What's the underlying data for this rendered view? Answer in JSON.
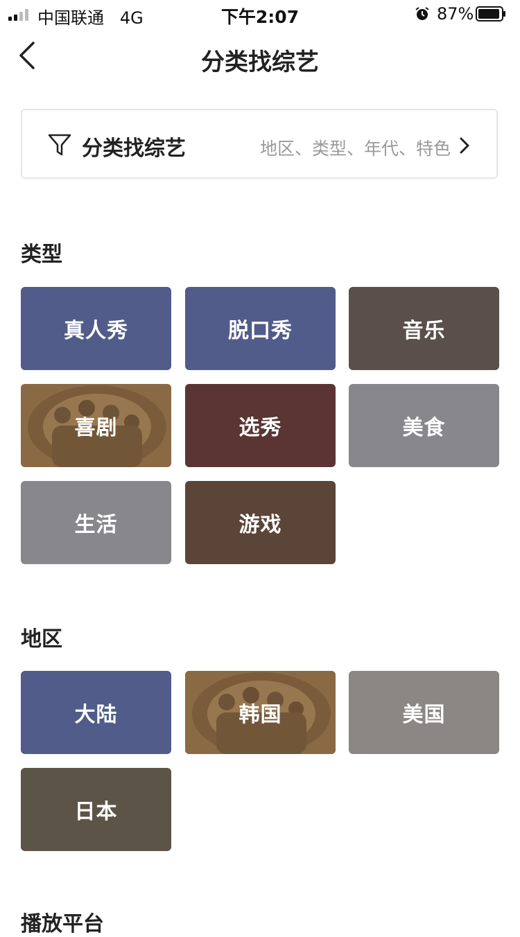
{
  "status_bar": {
    "carrier": "中国联通",
    "network": "4G",
    "time": "下午2:07",
    "battery": "87%"
  },
  "nav": {
    "title": "分类找综艺",
    "back_icon": "chevron-left-icon"
  },
  "filter": {
    "title": "分类找综艺",
    "hint": "地区、类型、年代、特色",
    "icon": "filter-funnel-icon"
  },
  "sections": {
    "type": {
      "title": "类型",
      "items": [
        {
          "label": "真人秀",
          "color": "#525c8a"
        },
        {
          "label": "脱口秀",
          "color": "#525c8a"
        },
        {
          "label": "音乐",
          "color": "#5a4f4a"
        },
        {
          "label": "喜剧",
          "color": "#8a6a45"
        },
        {
          "label": "选秀",
          "color": "#5a3534"
        },
        {
          "label": "美食",
          "color": "#88878c"
        },
        {
          "label": "生活",
          "color": "#88878c"
        },
        {
          "label": "游戏",
          "color": "#5b4438"
        }
      ]
    },
    "region": {
      "title": "地区",
      "items": [
        {
          "label": "大陆",
          "color": "#525c8a"
        },
        {
          "label": "韩国",
          "color": "#8a6a45"
        },
        {
          "label": "美国",
          "color": "#8b8784"
        },
        {
          "label": "日本",
          "color": "#5c5446"
        }
      ]
    },
    "platform": {
      "title": "播放平台"
    }
  }
}
